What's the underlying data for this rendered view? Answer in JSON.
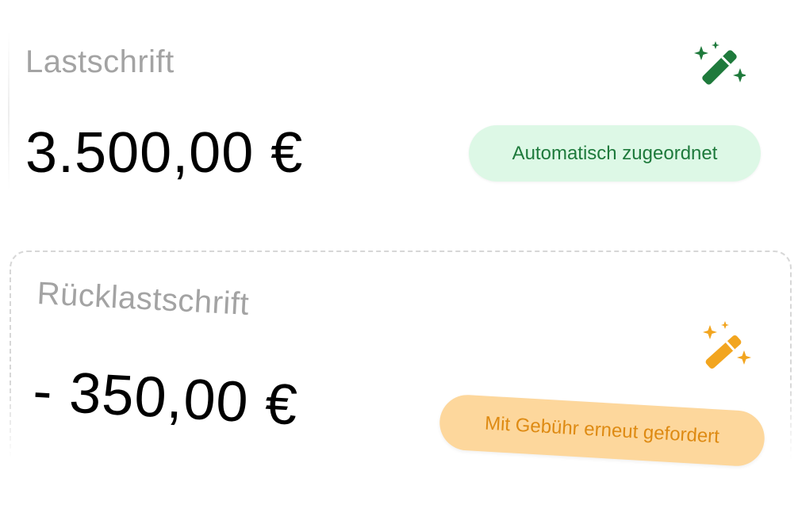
{
  "cards": [
    {
      "label": "Lastschrift",
      "amount": "3.500,00 €",
      "icon": "magic-wand-icon",
      "badge": "Automatisch zugeordnet",
      "accent_color": "#1f7a3c",
      "badge_bg": "#ddf8e6"
    },
    {
      "label": "Rücklastschrift",
      "amount": "- 350,00 €",
      "icon": "magic-wand-icon",
      "badge": "Mit Gebühr erneut gefordert",
      "accent_color": "#f2a51f",
      "badge_bg": "#fdd79c"
    }
  ]
}
